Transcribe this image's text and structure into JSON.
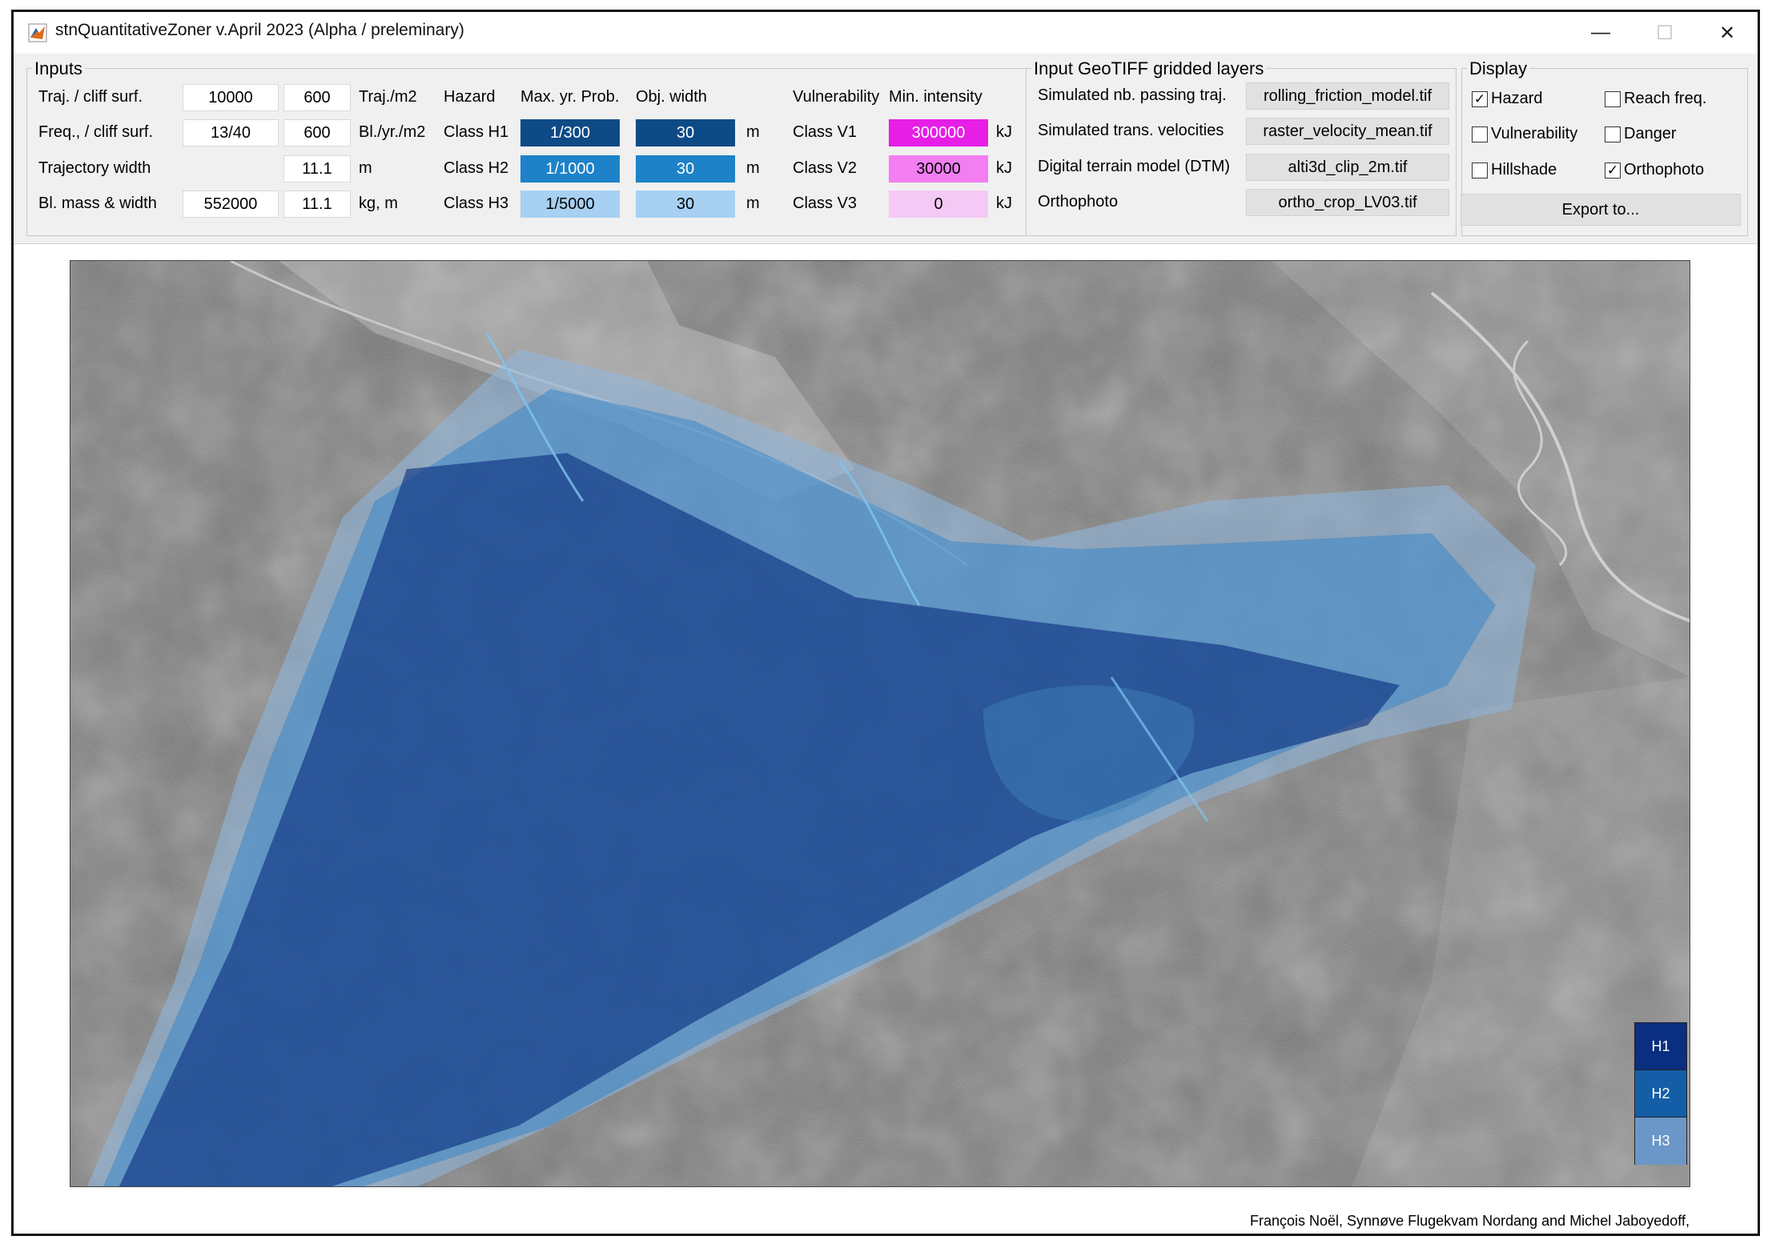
{
  "window": {
    "title": "stnQuantitativeZoner v.April 2023 (Alpha / preleminary)",
    "minimize": "—",
    "maximize": "☐",
    "close": "✕"
  },
  "inputs": {
    "title": "Inputs",
    "rows": [
      {
        "label": "Traj. / cliff surf.",
        "v1": "10000",
        "v2": "600",
        "unit": "Traj./m2"
      },
      {
        "label": "Freq., / cliff surf.",
        "v1": "13/40",
        "v2": "600",
        "unit": "Bl./yr./m2"
      },
      {
        "label": "Trajectory width",
        "v1": "",
        "v2": "11.1",
        "unit": "m"
      },
      {
        "label": "Bl. mass & width",
        "v1": "552000",
        "v2": "11.1",
        "unit": "kg, m"
      }
    ],
    "hazard_header": "Hazard",
    "prob_header": "Max. yr. Prob.",
    "width_header": "Obj. width",
    "vuln_header": "Vulnerability",
    "intensity_header": "Min. intensity",
    "hazard_classes": [
      {
        "label": "Class H1",
        "prob": "1/300",
        "width": "30",
        "unit": "m",
        "color": "#0e4a86",
        "text_color": "#ffffff"
      },
      {
        "label": "Class H2",
        "prob": "1/1000",
        "width": "30",
        "unit": "m",
        "color": "#1d82c8",
        "text_color": "#ffffff"
      },
      {
        "label": "Class H3",
        "prob": "1/5000",
        "width": "30",
        "unit": "m",
        "color": "#a7d0f2",
        "text_color": "#000000"
      }
    ],
    "vuln_classes": [
      {
        "label": "Class V1",
        "value": "300000",
        "unit": "kJ",
        "color": "#e61ee6",
        "text_color": "#ffffff"
      },
      {
        "label": "Class V2",
        "value": "30000",
        "unit": "kJ",
        "color": "#f27ef2",
        "text_color": "#000000"
      },
      {
        "label": "Class V3",
        "value": "0",
        "unit": "kJ",
        "color": "#f5c9f5",
        "text_color": "#000000"
      }
    ]
  },
  "geotiff": {
    "title": "Input GeoTIFF gridded layers",
    "layers": [
      {
        "label": "Simulated nb. passing traj.",
        "file": "rolling_friction_model.tif"
      },
      {
        "label": "Simulated trans. velocities",
        "file": "raster_velocity_mean.tif"
      },
      {
        "label": "Digital terrain model (DTM)",
        "file": "alti3d_clip_2m.tif"
      },
      {
        "label": "Orthophoto",
        "file": "ortho_crop_LV03.tif"
      }
    ]
  },
  "display": {
    "title": "Display",
    "options": [
      {
        "label": "Hazard",
        "checked": true
      },
      {
        "label": "Reach freq.",
        "checked": false
      },
      {
        "label": "Vulnerability",
        "checked": false
      },
      {
        "label": "Danger",
        "checked": false
      },
      {
        "label": "Hillshade",
        "checked": false
      },
      {
        "label": "Orthophoto",
        "checked": true
      }
    ],
    "export_label": "Export to..."
  },
  "legend": [
    {
      "label": "H1",
      "color": "#0a2f80"
    },
    {
      "label": "H2",
      "color": "#145ea8"
    },
    {
      "label": "H3",
      "color": "#6b97c8"
    }
  ],
  "credits": "François Noël, Synnøve Flugekvam Nordang and Michel Jaboyedoff,"
}
